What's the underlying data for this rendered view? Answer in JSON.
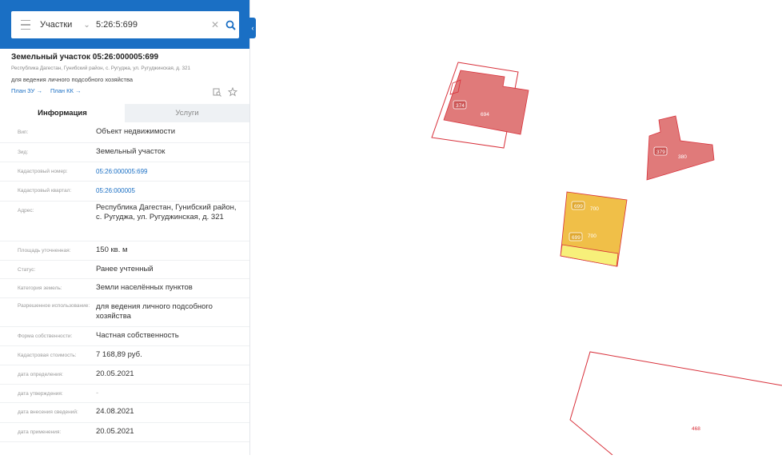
{
  "search": {
    "layer": "Участки",
    "query": "5:26:5:699"
  },
  "object": {
    "title": "Земельный участок 05:26:000005:699",
    "address_line": "Республика Дагестан, Гунибский район, с. Ругуджа, ул. Ругуджинская, д. 321",
    "purpose": "для ведения личного подсобного хозяйства",
    "links": [
      "План ЗУ →",
      "План КК →"
    ]
  },
  "tabs": [
    "Информация",
    "Услуги"
  ],
  "rows": [
    {
      "label": "Вип:",
      "value": "Объект недвижимости"
    },
    {
      "label": "Зид:",
      "value": "Земельный участок"
    },
    {
      "label": "Кадастровый номер:",
      "value": "05:26:000005:699",
      "link": true
    },
    {
      "label": "Кадастровый квартал:",
      "value": "05:26:000005",
      "link": true
    },
    {
      "label": "Адрес:",
      "value": "Республика Дагестан, Гунибский район, с. Ругуджа, ул. Ругуджинская, д. 321"
    },
    {
      "label": "Площадь уточненная:",
      "value": "150 кв. м"
    },
    {
      "label": "Статус:",
      "value": "Ранее учтенный"
    },
    {
      "label": "Категория земель:",
      "value": "Земли населённых пунктов"
    },
    {
      "label": "Разрешенное использование:",
      "value": "для ведения личного подсобного хозяйства"
    },
    {
      "label": "Форма собственности:",
      "value": "Частная собственность"
    },
    {
      "label": "Кадастровая стоимость:",
      "value": "7 168,89 руб."
    },
    {
      "label": "дата определения:",
      "value": "20.05.2021"
    },
    {
      "label": "дата утверждения:",
      "value": "-",
      "dash": true
    },
    {
      "label": "дата внесения сведений:",
      "value": "24.08.2021"
    },
    {
      "label": "дата применения:",
      "value": "20.05.2021"
    }
  ],
  "map": {
    "labels": [
      "374",
      "694",
      "379",
      "380",
      "699",
      "700",
      "468"
    ]
  },
  "colors": {
    "header": "#1a6fc4",
    "parcel_red": "#e07a7a",
    "parcel_orange": "#f0bf48",
    "parcel_yellow": "#f7f07a",
    "border_red": "#d8303a"
  }
}
